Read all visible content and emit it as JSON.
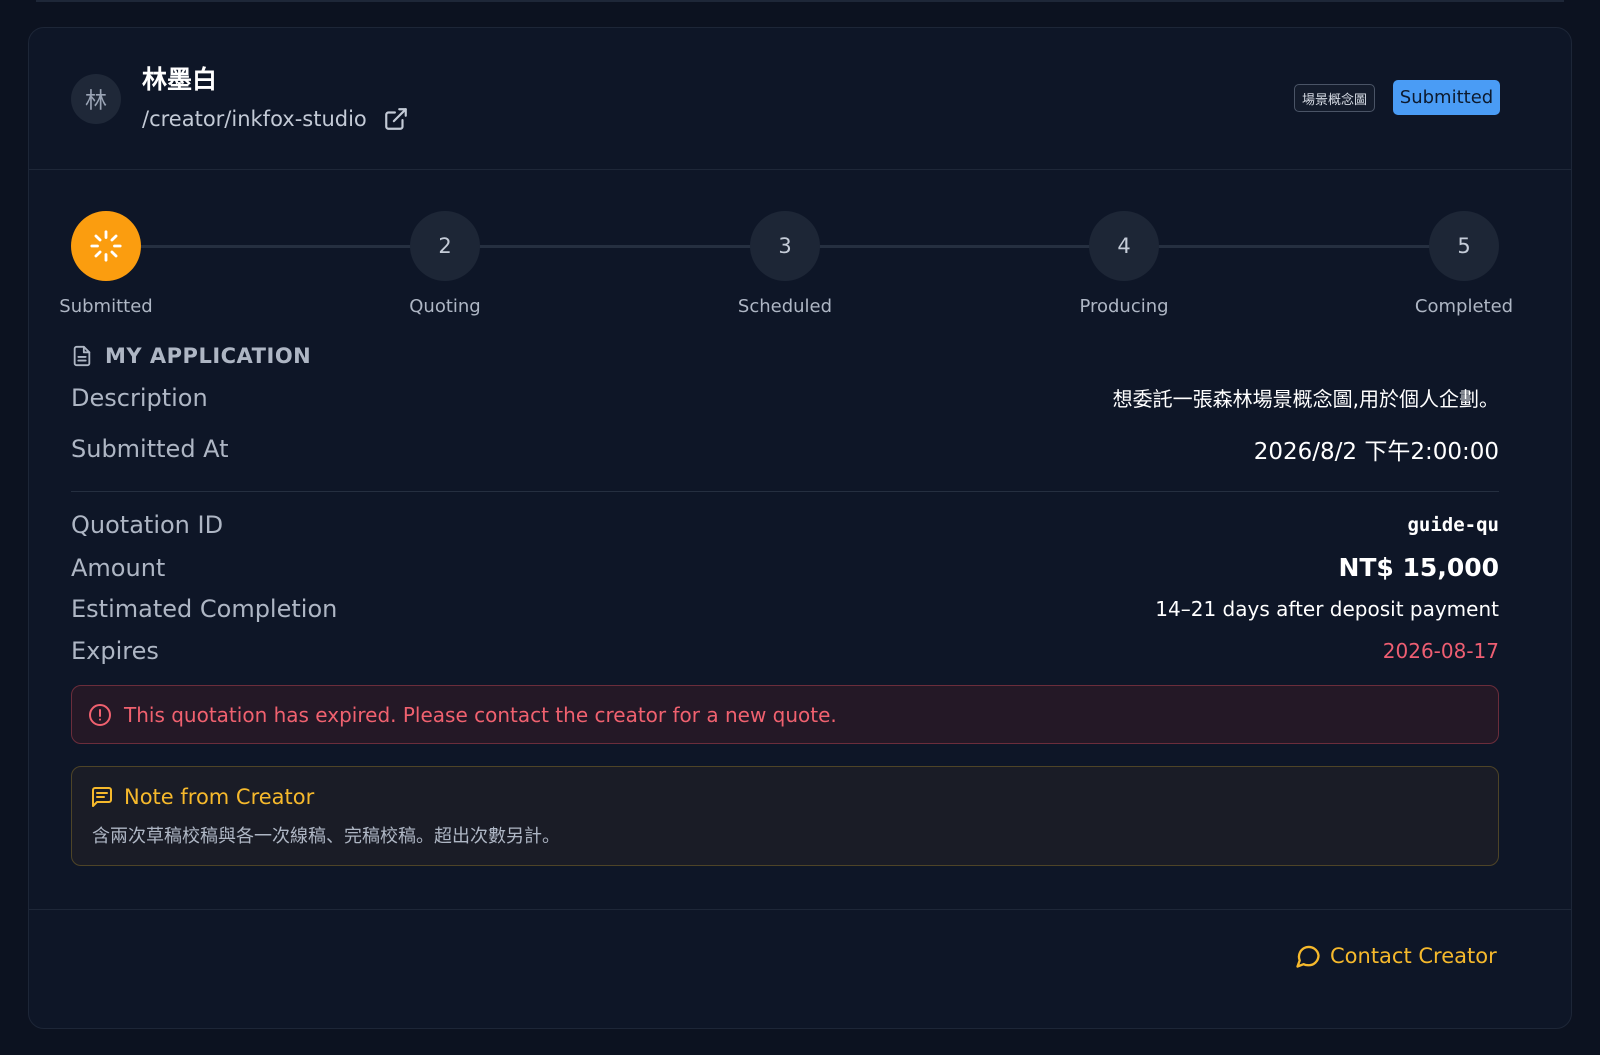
{
  "creator": {
    "avatar_initial": "林",
    "name": "林墨白",
    "path": "/creator/inkfox-studio"
  },
  "header": {
    "tag": "場景概念圖",
    "status": "Submitted"
  },
  "stepper": {
    "steps": [
      {
        "number": "",
        "label": "Submitted",
        "active": true
      },
      {
        "number": "2",
        "label": "Quoting",
        "active": false
      },
      {
        "number": "3",
        "label": "Scheduled",
        "active": false
      },
      {
        "number": "4",
        "label": "Producing",
        "active": false
      },
      {
        "number": "5",
        "label": "Completed",
        "active": false
      }
    ]
  },
  "application": {
    "section_title": "MY APPLICATION",
    "description_label": "Description",
    "description_value": "想委託一張森林場景概念圖,用於個人企劃。",
    "submitted_label": "Submitted At",
    "submitted_value": "2026/8/2 下午2:00:00"
  },
  "quotation": {
    "id_label": "Quotation ID",
    "id_value": "guide-qu",
    "amount_label": "Amount",
    "amount_value": "NT$ 15,000",
    "completion_label": "Estimated Completion",
    "completion_value": "14–21 days after deposit payment",
    "expires_label": "Expires",
    "expires_value": "2026-08-17"
  },
  "alert": {
    "message": "This quotation has expired. Please contact the creator for a new quote."
  },
  "note": {
    "title": "Note from Creator",
    "body": "含兩次草稿校稿與各一次線稿、完稿校稿。超出次數另計。"
  },
  "footer": {
    "contact_label": "Contact Creator"
  },
  "colors": {
    "accent": "#fb9d0f",
    "status_badge": "#4a9cf5",
    "danger": "#f0616f",
    "note_title": "#f6b92c"
  }
}
